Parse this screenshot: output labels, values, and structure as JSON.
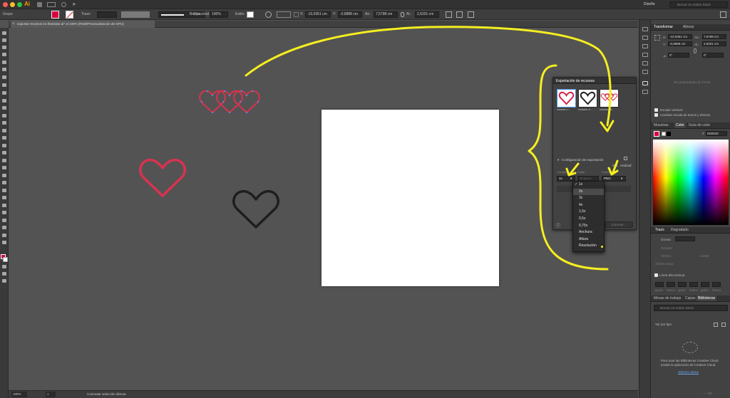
{
  "appbar": {
    "logo": "Ai",
    "workspace": "Diseño",
    "search_placeholder": "Buscar en Adobe Stock"
  },
  "controlbar": {
    "object_type": "Grupo",
    "stroke_label": "Trazo",
    "style_name": "Básico",
    "opacity_label": "Opacidad:",
    "opacity_value": "100%",
    "style_label": "Estilo:",
    "x_label": "X:",
    "x_value": "-10,0351 cm",
    "y_label": "Y:",
    "y_value": "-0,8888 cm",
    "w_label": "An.:",
    "w_value": "7,5798 cm",
    "h_label": "Al.:",
    "h_value": "2,6201 cm"
  },
  "document_tab": {
    "title": "exportar recursos en illustrator.ai* al 100% (RGB/Previsualización de GPU)",
    "close_glyph": "×"
  },
  "statusbar": {
    "zoom": "100%",
    "artboard": "1",
    "mode": "Conmutar selección directa"
  },
  "transform_panel": {
    "tabs": [
      "Transformar",
      "Alinear"
    ],
    "x_label": "X:",
    "x_value": "-10,0351 cm",
    "y_label": "Y:",
    "y_value": "-0,8888 cm",
    "w_label": "An.:",
    "w_value": "7,5798 cm",
    "h_label": "Al.:",
    "h_value": "2,6201 cm",
    "angle_label": "⊿:",
    "angle_value": "0°",
    "shear_value": "0°",
    "no_properties": "Sin propiedades de forma",
    "scale_corners": "Escalar vértices",
    "scale_strokes": "Cambiar escala de trazos y efectos"
  },
  "color_panel": {
    "tabs": [
      "Muestras",
      "Color",
      "Guía de color"
    ],
    "hex_prefix": "#",
    "hex_value": "D80040",
    "current_color": "#d80040"
  },
  "stroke_panel": {
    "tabs": [
      "Trazo",
      "Degradado"
    ],
    "weight_label": "Grosor:",
    "cap_label": "Remate:",
    "corner_label": "Vértice:",
    "limit_label": "Límite:",
    "align_label": "Alinear trazo:",
    "dashed_label": "Línea discontinua",
    "dash_cells": [
      "guión",
      "hueco",
      "guión",
      "hueco",
      "guión",
      "hueco"
    ]
  },
  "libraries_panel": {
    "tabs": [
      "Mesas de trabajo",
      "Capas",
      "Bibliotecas"
    ],
    "search_placeholder": "Buscar en Adobe Stock",
    "view_label": "Ver por tipo",
    "message_line1": "Para usar las Bibliotecas Creative Cloud",
    "message_line2": "instale la aplicación de Creative Cloud.",
    "link_text": "Obtener ahora",
    "size": "— KB"
  },
  "export_panel": {
    "title": "Exportación de recursos",
    "assets": [
      {
        "label": "corazón r...",
        "stroke": "#d6224a"
      },
      {
        "label": "corazón n...",
        "stroke": "#222222"
      },
      {
        "label": "corazones",
        "stroke": "#d6224a"
      }
    ],
    "settings_label": "Configuración de exportación",
    "presets": [
      "iOS",
      "Android"
    ],
    "col_scale": "Escala",
    "col_suffix": "Sufijo",
    "col_format": "Formato",
    "scale_value": "1x",
    "suffix_placeholder": "Ninguno",
    "format_value": "PNG",
    "export_button": "Exportar...",
    "info_glyph": "ⓘ"
  },
  "scale_dropdown": {
    "options": [
      "1x",
      "2x",
      "3x",
      "4x",
      "1,5x",
      "0,5x",
      "0,75x",
      "Anchura",
      "Altura",
      "Resolución"
    ],
    "checked": "1x",
    "highlighted": "2x"
  },
  "canvas_art": {
    "red_heart_color": "#d8334f",
    "black_heart_color": "#1e1e1e",
    "annotation_color": "#f5ee20"
  }
}
